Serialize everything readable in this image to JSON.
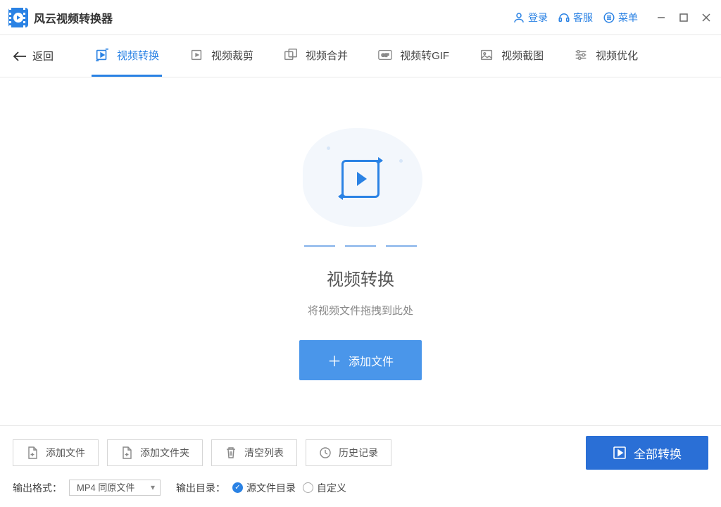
{
  "app": {
    "title": "风云视频转换器"
  },
  "titlebar": {
    "login": "登录",
    "support": "客服",
    "menu": "菜单"
  },
  "nav": {
    "back": "返回",
    "tabs": [
      {
        "label": "视频转换",
        "icon": "convert",
        "active": true
      },
      {
        "label": "视频裁剪",
        "icon": "crop",
        "active": false
      },
      {
        "label": "视频合并",
        "icon": "merge",
        "active": false
      },
      {
        "label": "视频转GIF",
        "icon": "gif",
        "active": false
      },
      {
        "label": "视频截图",
        "icon": "screenshot",
        "active": false
      },
      {
        "label": "视频优化",
        "icon": "optimize",
        "active": false
      }
    ]
  },
  "main": {
    "title": "视频转换",
    "subtitle": "将视频文件拖拽到此处",
    "add_button": "添加文件"
  },
  "bottom": {
    "buttons": [
      {
        "label": "添加文件",
        "icon": "file-add"
      },
      {
        "label": "添加文件夹",
        "icon": "folder-add"
      },
      {
        "label": "清空列表",
        "icon": "trash"
      },
      {
        "label": "历史记录",
        "icon": "history"
      }
    ],
    "convert_all": "全部转换",
    "format_label": "输出格式：",
    "format_value": "MP4 同原文件",
    "dir_label": "输出目录：",
    "radio_source": "源文件目录",
    "radio_custom": "自定义"
  }
}
